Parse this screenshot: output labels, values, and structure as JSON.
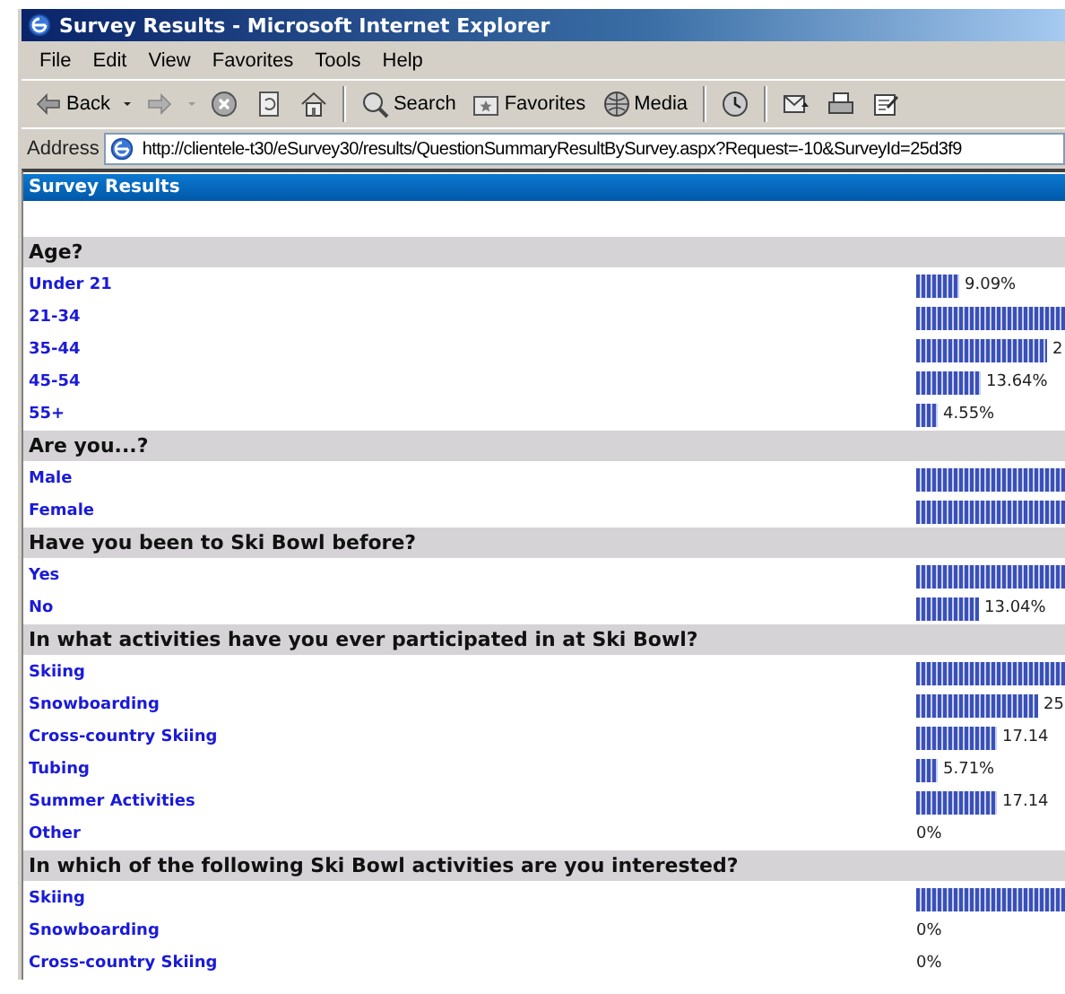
{
  "window": {
    "title": "Survey Results - Microsoft Internet Explorer"
  },
  "menu": [
    "File",
    "Edit",
    "View",
    "Favorites",
    "Tools",
    "Help"
  ],
  "toolbar": [
    {
      "kind": "back",
      "label": "Back"
    },
    {
      "kind": "forward"
    },
    {
      "kind": "stop"
    },
    {
      "kind": "refresh"
    },
    {
      "kind": "home"
    },
    {
      "kind": "search",
      "label": "Search"
    },
    {
      "kind": "favorites",
      "label": "Favorites"
    },
    {
      "kind": "media",
      "label": "Media"
    },
    {
      "kind": "history"
    },
    {
      "kind": "mail"
    },
    {
      "kind": "print"
    },
    {
      "kind": "edit"
    }
  ],
  "address": {
    "label": "Address",
    "value": "http://clientele-t30/eSurvey30/results/QuestionSummaryResultBySurvey.aspx?Request=-10&SurveyId=25d3f9"
  },
  "page": {
    "title": "Survey Results",
    "questions": [
      {
        "text": "Age?",
        "answers": [
          {
            "label": "Under 21",
            "reading": "9.09%"
          },
          {
            "label": "21-34"
          },
          {
            "label": "35-44",
            "reading": "2"
          },
          {
            "label": "45-54",
            "reading": "13.64%"
          },
          {
            "label": "55+",
            "reading": "4.55%"
          }
        ]
      },
      {
        "text": "Are you...?",
        "answers": [
          {
            "label": "Male"
          },
          {
            "label": "Female"
          }
        ]
      },
      {
        "text": "Have you been to Ski Bowl before?",
        "answers": [
          {
            "label": "Yes"
          },
          {
            "label": "No",
            "reading": "13.04%"
          }
        ]
      },
      {
        "text": "In what activities have you ever participated in at Ski Bowl?",
        "answers": [
          {
            "label": "Skiing"
          },
          {
            "label": "Snowboarding",
            "reading": "25"
          },
          {
            "label": "Cross-country Skiing",
            "reading": "17.14"
          },
          {
            "label": "Tubing",
            "reading": "5.71%"
          },
          {
            "label": "Summer Activities",
            "reading": "17.14"
          },
          {
            "label": "Other",
            "reading": "0%"
          }
        ]
      },
      {
        "text": "In which of the following Ski Bowl activities are you interested?",
        "answers": [
          {
            "label": "Skiing"
          },
          {
            "label": "Snowboarding",
            "reading": "0%"
          },
          {
            "label": "Cross-country Skiing",
            "reading": "0%"
          }
        ]
      }
    ]
  }
}
